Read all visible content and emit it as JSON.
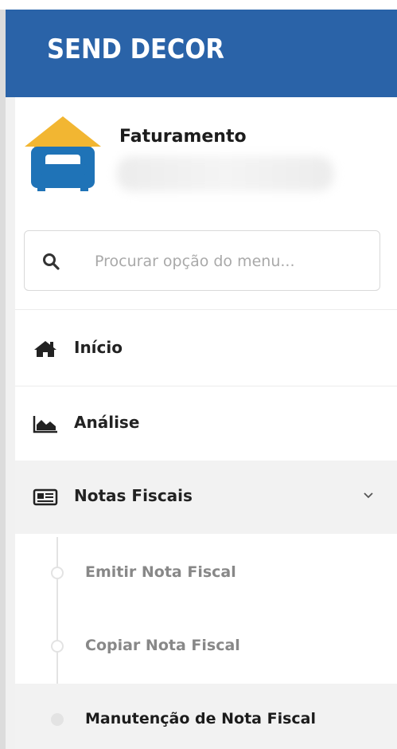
{
  "header": {
    "title": "SEND DECOR"
  },
  "profile": {
    "name": "Faturamento",
    "logo_icon": "sofa-house-logo"
  },
  "search": {
    "placeholder": "Procurar opção do menu...",
    "icon": "search-icon"
  },
  "menu": [
    {
      "label": "Início",
      "icon": "home-icon"
    },
    {
      "label": "Análise",
      "icon": "area-chart-icon"
    },
    {
      "label": "Notas Fiscais",
      "icon": "newspaper-icon",
      "expanded": true
    }
  ],
  "submenu": [
    {
      "label": "Emitir Nota Fiscal"
    },
    {
      "label": "Copiar Nota Fiscal"
    },
    {
      "label": "Manutenção de Nota Fiscal",
      "current": true
    }
  ],
  "colors": {
    "header_bg": "#2a63a8",
    "logo_roof": "#f2b632",
    "logo_sofa": "#1f73b7",
    "active_bg": "#f2f2f2"
  }
}
